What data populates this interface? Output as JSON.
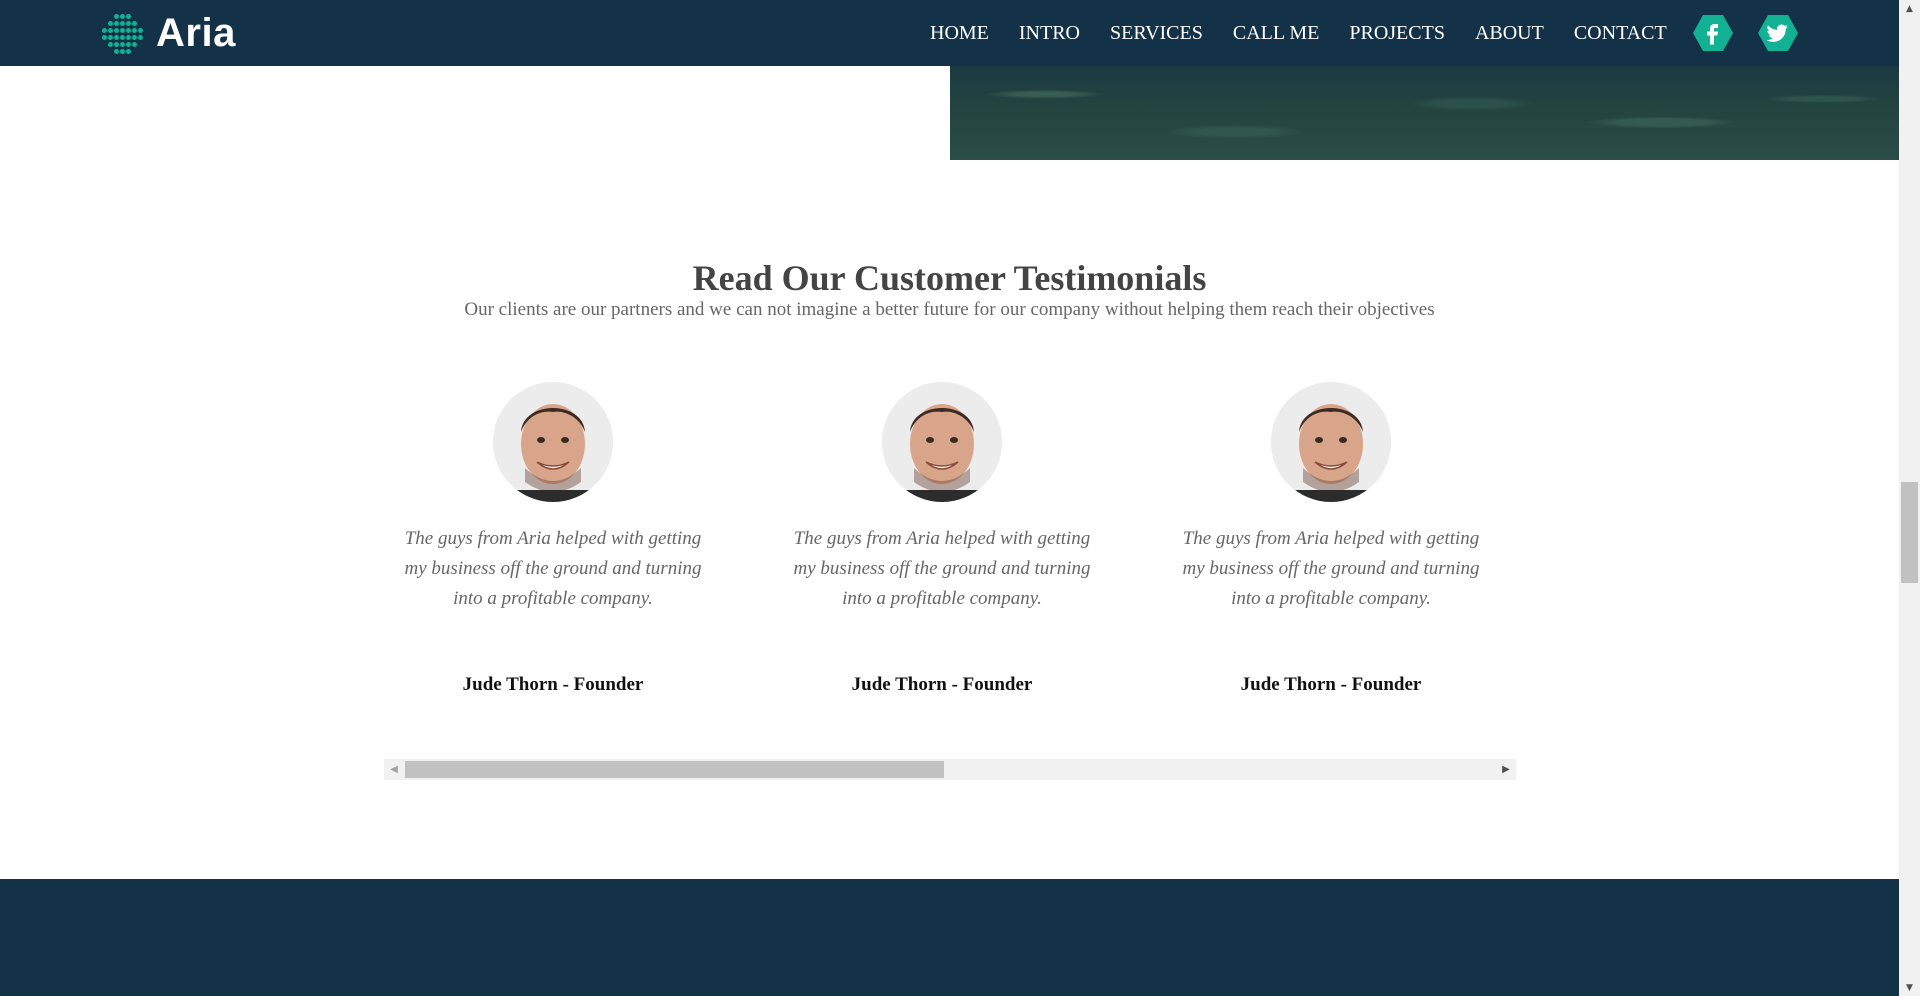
{
  "brand": {
    "name": "Aria",
    "accent": "#13b194",
    "navbar_bg": "#133248"
  },
  "nav": {
    "items": [
      "HOME",
      "INTRO",
      "SERVICES",
      "CALL ME",
      "PROJECTS",
      "ABOUT",
      "CONTACT"
    ],
    "social": [
      {
        "icon": "facebook-icon",
        "glyph": "f"
      },
      {
        "icon": "twitter-icon",
        "glyph": "t"
      }
    ]
  },
  "testimonials": {
    "title": "Read Our Customer Testimonials",
    "subtitle": "Our clients are our partners and we can not imagine a better future for our company without helping them reach their objectives",
    "cards": [
      {
        "quote": "The guys from Aria helped with getting my business off the ground and turning into a profitable company.",
        "author": "Jude Thorn - Founder"
      },
      {
        "quote": "The guys from Aria helped with getting my business off the ground and turning into a profitable company.",
        "author": "Jude Thorn - Founder"
      },
      {
        "quote": "The guys from Aria helped with getting my business off the ground and turning into a profitable company.",
        "author": "Jude Thorn - Founder"
      }
    ]
  },
  "carousel_scroll": {
    "position": 0
  }
}
